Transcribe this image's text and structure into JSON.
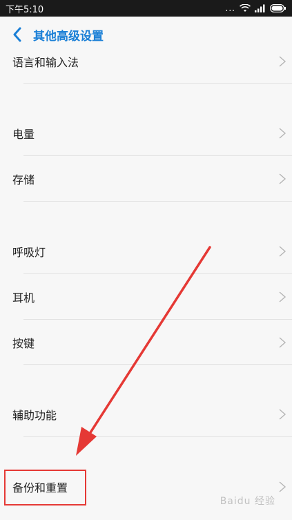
{
  "status_bar": {
    "time": "下午5:10",
    "dots": "..."
  },
  "header": {
    "title": "其他高级设置"
  },
  "items": [
    {
      "label": "语言和输入法"
    },
    {
      "label": "电量"
    },
    {
      "label": "存储"
    },
    {
      "label": "呼吸灯"
    },
    {
      "label": "耳机"
    },
    {
      "label": "按键"
    },
    {
      "label": "辅助功能"
    },
    {
      "label": "备份和重置"
    }
  ],
  "watermark": "Baidu 经验",
  "colors": {
    "accent": "#1a7fd6",
    "annotation": "#e53935",
    "background": "#f7f7f7"
  },
  "icons": [
    "back-arrow-icon",
    "wifi-icon",
    "signal-icon",
    "battery-icon",
    "chevron-right-icon"
  ]
}
